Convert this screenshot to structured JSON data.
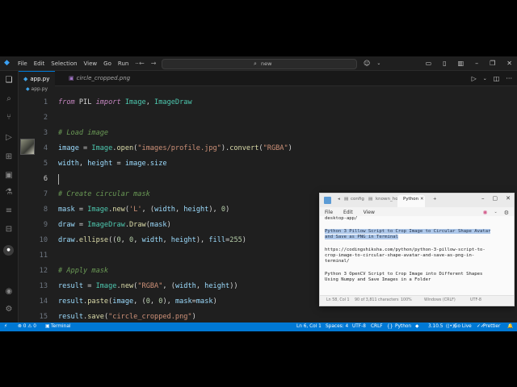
{
  "titlebar": {
    "menu": [
      "File",
      "Edit",
      "Selection",
      "View",
      "Go",
      "Run",
      "···"
    ],
    "search_text": "new"
  },
  "tabs": [
    {
      "label": "app.py",
      "active": true
    },
    {
      "label": "circle_cropped.png",
      "active": false
    }
  ],
  "breadcrumb": "app.py",
  "code": [
    {
      "n": "1",
      "html": "<span class=\"kw\">from</span> PIL <span class=\"kw\">import</span> <span class=\"cls\">Image</span>, <span class=\"cls\">ImageDraw</span>"
    },
    {
      "n": "2",
      "html": ""
    },
    {
      "n": "3",
      "html": "<span class=\"cm\"># Load image</span>"
    },
    {
      "n": "4",
      "html": "<span class=\"id\">image</span> = <span class=\"cls\">Image</span>.<span class=\"fn\">open</span>(<span class=\"st2\">\"images/profile.jpg\"</span>).<span class=\"fn\">convert</span>(<span class=\"st2\">\"RGBA\"</span>)"
    },
    {
      "n": "5",
      "html": "<span class=\"id\">width</span>, <span class=\"id\">height</span> = <span class=\"id\">image</span>.<span class=\"id\">size</span>"
    },
    {
      "n": "6",
      "html": ""
    },
    {
      "n": "7",
      "html": "<span class=\"cm\"># Create circular mask</span>"
    },
    {
      "n": "8",
      "html": "<span class=\"id\">mask</span> = <span class=\"cls\">Image</span>.<span class=\"fn\">new</span>(<span class=\"st2\">'L'</span>, (<span class=\"id\">width</span>, <span class=\"id\">height</span>), <span class=\"nm\">0</span>)"
    },
    {
      "n": "9",
      "html": "<span class=\"id\">draw</span> = <span class=\"cls\">ImageDraw</span>.<span class=\"fn\">Draw</span>(<span class=\"id\">mask</span>)"
    },
    {
      "n": "10",
      "html": "<span class=\"id\">draw</span>.<span class=\"fn\">ellipse</span>((<span class=\"nm\">0</span>, <span class=\"nm\">0</span>, <span class=\"id\">width</span>, <span class=\"id\">height</span>), <span class=\"id\">fill</span>=<span class=\"nm\">255</span>)"
    },
    {
      "n": "11",
      "html": ""
    },
    {
      "n": "12",
      "html": "<span class=\"cm\"># Apply mask</span>"
    },
    {
      "n": "13",
      "html": "<span class=\"id\">result</span> = <span class=\"cls\">Image</span>.<span class=\"fn\">new</span>(<span class=\"st2\">\"RGBA\"</span>, (<span class=\"id\">width</span>, <span class=\"id\">height</span>))"
    },
    {
      "n": "14",
      "html": "<span class=\"id\">result</span>.<span class=\"fn\">paste</span>(<span class=\"id\">image</span>, (<span class=\"nm\">0</span>, <span class=\"nm\">0</span>), <span class=\"id\">mask</span>=<span class=\"id\">mask</span>)"
    },
    {
      "n": "15",
      "html": "<span class=\"id\">result</span>.<span class=\"fn\">save</span>(<span class=\"st2\">\"circle_cropped.png\"</span>)"
    }
  ],
  "current_line": "6",
  "notepad": {
    "tabs": [
      "config",
      "known_hosts",
      "Python"
    ],
    "menu": [
      "File",
      "Edit",
      "View"
    ],
    "lines": {
      "path": "desktop-app/",
      "sel1": "Python 3 Pillow Script to Crop Image to Circular Shape Avatar",
      "sel2": "and Save as PNG in Terminal",
      "url1": "https://codingshiksha.com/python/python-3-pillow-script-to-",
      "url2": "crop-image-to-circular-shape-avatar-and-save-as-png-in-",
      "url3": "terminal/",
      "p2a": "Python 3 OpenCV Script to Crop Image into Different Shapes",
      "p2b": "Using Numpy and Save Images in a Folder"
    },
    "status": {
      "pos": "Ln 58, Col 1",
      "chars": "90 of 3,811 characters",
      "zoom": "100%",
      "eol": "Windows (CRLF)",
      "enc": "UTF-8"
    }
  },
  "statusbar": {
    "errors": "⊗ 0 ⚠ 0",
    "terminal": "Terminal",
    "position": "Ln 6, Col 1",
    "spaces": "Spaces: 4",
    "encoding": "UTF-8",
    "eol": "CRLF",
    "language": "Python",
    "version": "3.10.5",
    "golive": "Go Live",
    "prettier": "Prettier"
  },
  "colors": {
    "accent": "#0078d4",
    "editor_bg": "#1f1f1f",
    "selection": "#aec8ea"
  }
}
